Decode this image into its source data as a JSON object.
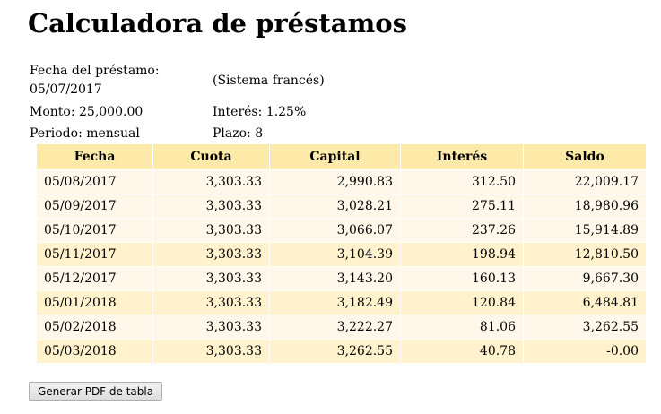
{
  "page": {
    "title": "Calculadora de préstamos"
  },
  "loan_info": {
    "fecha_label": "Fecha del préstamo:",
    "fecha_value": "05/07/2017",
    "sistema": "(Sistema francés)",
    "monto": "Monto: 25,000.00",
    "interes": "Interés: 1.25%",
    "periodo": "Periodo: mensual",
    "plazo": "Plazo: 8"
  },
  "table": {
    "headers": [
      "Fecha",
      "Cuota",
      "Capital",
      "Interés",
      "Saldo"
    ],
    "rows": [
      [
        "05/08/2017",
        "3,303.33",
        "2,990.83",
        "312.50",
        "22,009.17"
      ],
      [
        "05/09/2017",
        "3,303.33",
        "3,028.21",
        "275.11",
        "18,980.96"
      ],
      [
        "05/10/2017",
        "3,303.33",
        "3,066.07",
        "237.26",
        "15,914.89"
      ],
      [
        "05/11/2017",
        "3,303.33",
        "3,104.39",
        "198.94",
        "12,810.50"
      ],
      [
        "05/12/2017",
        "3,303.33",
        "3,143.20",
        "160.13",
        "9,667.30"
      ],
      [
        "05/01/2018",
        "3,303.33",
        "3,182.49",
        "120.84",
        "6,484.81"
      ],
      [
        "05/02/2018",
        "3,303.33",
        "3,222.27",
        "81.06",
        "3,262.55"
      ],
      [
        "05/03/2018",
        "3,303.33",
        "3,262.55",
        "40.78",
        "-0.00"
      ]
    ]
  },
  "actions": {
    "pdf_button": "Generar PDF de tabla"
  },
  "colors": {
    "header_bg": "#fde9a8",
    "row_light": "#fff8ea",
    "row_dark": "#fff2cc"
  }
}
